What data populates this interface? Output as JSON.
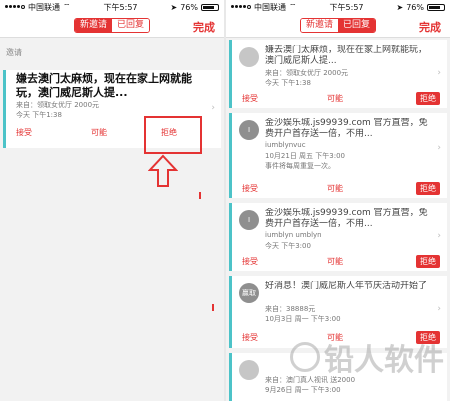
{
  "status_bar": {
    "carrier": "中国联通",
    "time": "下午5:57",
    "battery": "76%"
  },
  "nav": {
    "tab_new": "新邀请",
    "tab_replied": "已回复",
    "done": "完成"
  },
  "section_label": "邀请",
  "left_card": {
    "title": "嫌去澳门太麻烦，现在在家上网就能玩，澳门威尼斯人提...",
    "from": "来自：领取女优厅 2000元",
    "time": "今天 下午1:38",
    "accept": "接受",
    "maybe": "可能",
    "reject": "拒绝"
  },
  "right_cards": [
    {
      "avatar": "",
      "title": "嫌去澳门太麻烦，现在在家上网就能玩，澳门威尼斯人提...",
      "from": "来自：领取女优厅 2000元",
      "time": "今天 下午1:38",
      "accept": "接受",
      "maybe": "可能",
      "reject": "拒绝"
    },
    {
      "avatar": "I",
      "title": "金沙娱乐城.js99939.com 官方直营，免费开户首存送一倍，不用...",
      "from": "iumblynvuc",
      "time": "10月21日 周五 下午3:00",
      "extra": "事件将每周重复一次。",
      "accept": "接受",
      "maybe": "可能",
      "reject": "拒绝"
    },
    {
      "avatar": "I",
      "title": "金沙娱乐城.js99939.com 官方直营，免费开户首存送一倍，不用...",
      "from": "iumblyn umblyn",
      "time": "今天 下午3:00",
      "accept": "接受",
      "maybe": "可能",
      "reject": "拒绝"
    },
    {
      "avatar": "赢取",
      "title": "好消息！澳门威尼斯人年节庆活动开始了",
      "from": "来自：38888元",
      "time": "10月3日 周一 下午3:00",
      "accept": "接受",
      "maybe": "可能",
      "reject": "拒绝"
    },
    {
      "avatar": "",
      "title": "",
      "from": "来自：澳门真人视讯 送2000",
      "time": "9月26日 周一 下午3:00",
      "accept": "",
      "maybe": "",
      "reject": ""
    }
  ],
  "watermark": "铅人软件",
  "colors": {
    "accent": "#e43333",
    "card_stripe": "#4cc3c8"
  }
}
